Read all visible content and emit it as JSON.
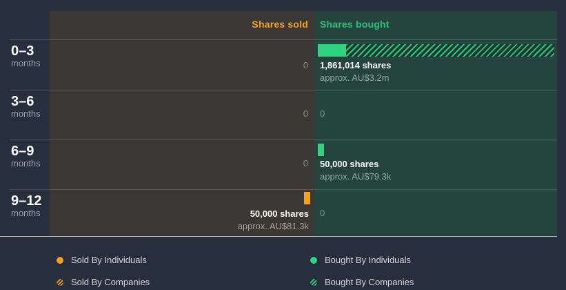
{
  "header": {
    "sold": "Shares sold",
    "bought": "Shares bought"
  },
  "rows": [
    {
      "period": "0–3",
      "unit": "months",
      "sold_zero": "0",
      "bought_line1": "1,861,014 shares",
      "bought_line2": "approx. AU$3.2m"
    },
    {
      "period": "3–6",
      "unit": "months",
      "sold_zero": "0",
      "bought_zero": "0"
    },
    {
      "period": "6–9",
      "unit": "months",
      "sold_zero": "0",
      "bought_line1": "50,000 shares",
      "bought_line2": "approx. AU$79.3k"
    },
    {
      "period": "9–12",
      "unit": "months",
      "sold_line1": "50,000 shares",
      "sold_line2": "approx. AU$81.3k",
      "bought_zero": "0"
    }
  ],
  "legend": {
    "sold_individuals": "Sold By Individuals",
    "sold_companies": "Sold By Companies",
    "bought_individuals": "Bought By Individuals",
    "bought_companies": "Bought By Companies"
  },
  "colors": {
    "background": "#272e3c",
    "sold_panel": "#3b3734",
    "bought_panel": "#26443e",
    "sold_accent": "#f9a01b",
    "bought_accent": "#2ed47f"
  },
  "chart_data": {
    "type": "bar",
    "orientation": "horizontal",
    "diverging": true,
    "categories": [
      "0–3 months",
      "3–6 months",
      "6–9 months",
      "9–12 months"
    ],
    "series": [
      {
        "name": "Sold By Individuals",
        "side": "sold",
        "pattern": "solid",
        "color": "#f9a01b",
        "values": [
          0,
          0,
          0,
          50000
        ]
      },
      {
        "name": "Sold By Companies",
        "side": "sold",
        "pattern": "hatched",
        "color": "#f9a01b",
        "values": [
          0,
          0,
          0,
          0
        ]
      },
      {
        "name": "Bought By Individuals",
        "side": "bought",
        "pattern": "solid",
        "color": "#2ed47f",
        "values": [
          220000,
          0,
          50000,
          0
        ]
      },
      {
        "name": "Bought By Companies",
        "side": "bought",
        "pattern": "hatched",
        "color": "#2ed47f",
        "values": [
          1641014,
          0,
          0,
          0
        ]
      }
    ],
    "totals": {
      "sold": [
        0,
        0,
        0,
        50000
      ],
      "bought": [
        1861014,
        0,
        50000,
        0
      ]
    },
    "value_labels": {
      "sold": [
        "0",
        "0",
        "0",
        "50,000 shares"
      ],
      "sold_approx": [
        "",
        "",
        "",
        "approx. AU$81.3k"
      ],
      "bought": [
        "1,861,014 shares",
        "0",
        "50,000 shares",
        "0"
      ],
      "bought_approx": [
        "approx. AU$3.2m",
        "",
        "approx. AU$79.3k",
        ""
      ]
    },
    "legend_position": "bottom",
    "grid": "row-separators"
  }
}
